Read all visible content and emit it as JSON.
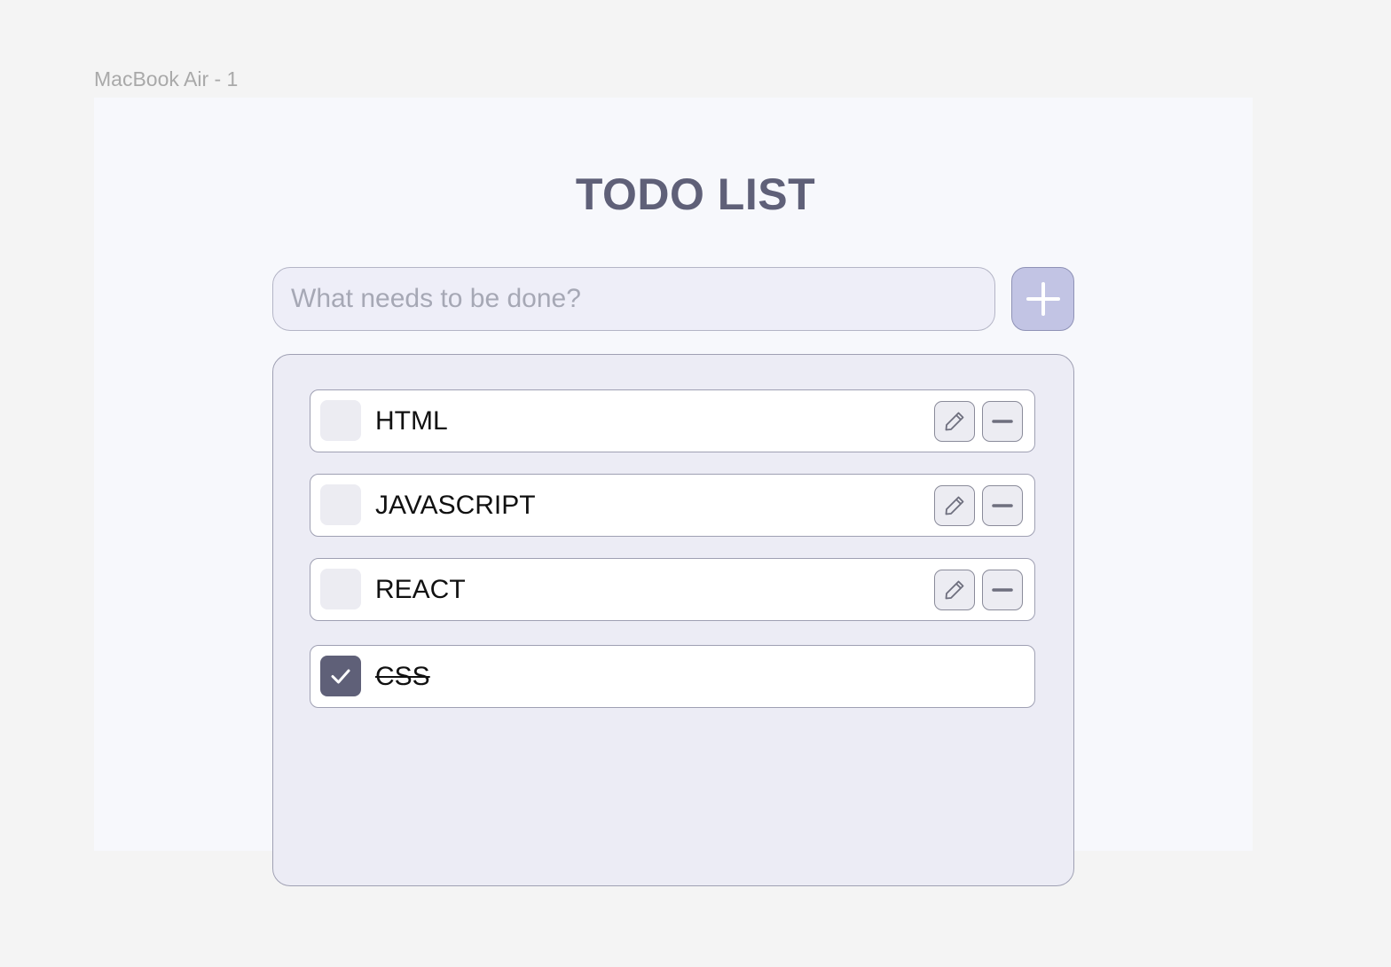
{
  "frame": {
    "label": "MacBook Air - 1"
  },
  "app": {
    "title": "TODO LIST",
    "input": {
      "placeholder": "What needs to be done?",
      "value": ""
    },
    "add_button": {
      "icon": "plus-icon"
    }
  },
  "todos": [
    {
      "label": "HTML",
      "done": false
    },
    {
      "label": "JAVASCRIPT",
      "done": false
    },
    {
      "label": "REACT",
      "done": false
    },
    {
      "label": "CSS",
      "done": true
    }
  ],
  "colors": {
    "background": "#f4f4f4",
    "frame_bg": "#f7f8fc",
    "title": "#5f6078",
    "accent_button": "#c2c4e4",
    "panel": "#ececf5",
    "checked": "#5f6078"
  },
  "icons": {
    "edit": "pencil-icon",
    "remove": "minus-icon",
    "check": "checkmark-icon"
  }
}
